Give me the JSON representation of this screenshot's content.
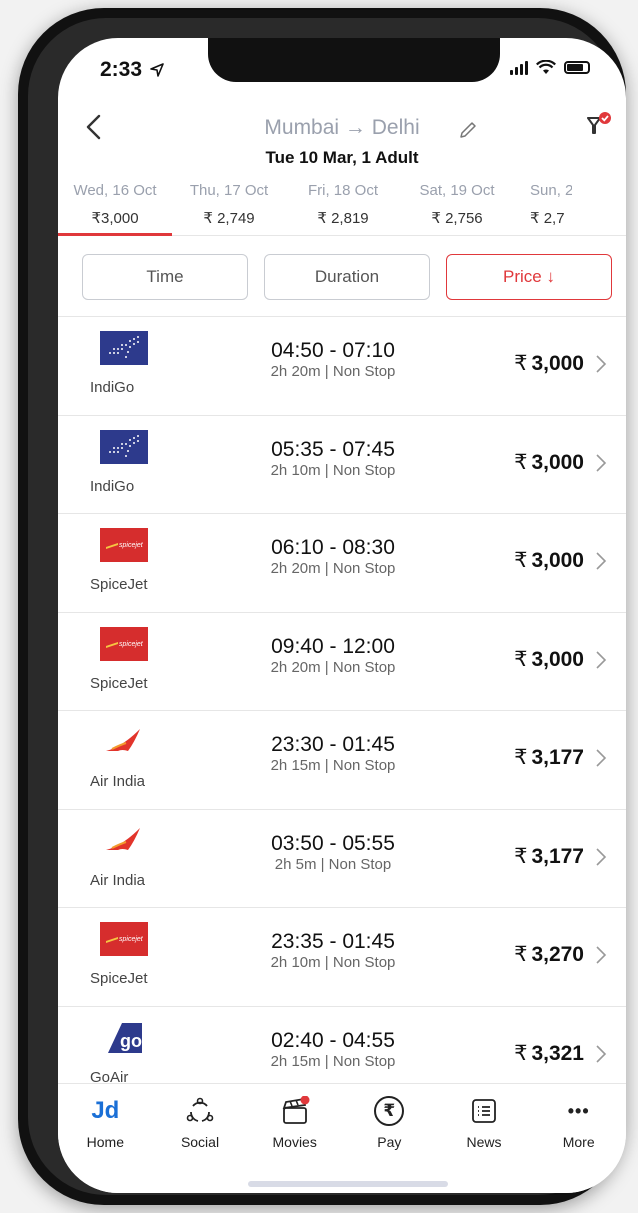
{
  "status": {
    "time": "2:33"
  },
  "header": {
    "route": "Mumbai → Delhi",
    "subtitle": "Tue 10 Mar, 1 Adult"
  },
  "dates": [
    {
      "date": "Wed, 16 Oct",
      "price": "₹3,000",
      "active": true
    },
    {
      "date": "Thu, 17 Oct",
      "price": "₹ 2,749"
    },
    {
      "date": "Fri, 18 Oct",
      "price": "₹ 2,819"
    },
    {
      "date": "Sat, 19 Oct",
      "price": "₹ 2,756"
    },
    {
      "date": "Sun, 2",
      "price": "₹ 2,7"
    }
  ],
  "sort": {
    "time": "Time",
    "duration": "Duration",
    "price": "Price ↓"
  },
  "flights": [
    {
      "airline": "IndiGo",
      "logo": "indigo",
      "times": "04:50 - 07:10",
      "meta": "2h 20m | Non Stop",
      "price": "3,000"
    },
    {
      "airline": "IndiGo",
      "logo": "indigo",
      "times": "05:35 - 07:45",
      "meta": "2h 10m | Non Stop",
      "price": "3,000"
    },
    {
      "airline": "SpiceJet",
      "logo": "spicejet",
      "times": "06:10 - 08:30",
      "meta": "2h 20m | Non Stop",
      "price": "3,000"
    },
    {
      "airline": "SpiceJet",
      "logo": "spicejet",
      "times": "09:40 - 12:00",
      "meta": "2h 20m | Non Stop",
      "price": "3,000"
    },
    {
      "airline": "Air India",
      "logo": "airindia",
      "times": "23:30 - 01:45",
      "meta": "2h 15m | Non Stop",
      "price": "3,177"
    },
    {
      "airline": "Air India",
      "logo": "airindia",
      "times": "03:50 - 05:55",
      "meta": "2h 5m | Non Stop",
      "price": "3,177"
    },
    {
      "airline": "SpiceJet",
      "logo": "spicejet",
      "times": "23:35 - 01:45",
      "meta": "2h 10m | Non Stop",
      "price": "3,270"
    },
    {
      "airline": "GoAir",
      "logo": "goair",
      "times": "02:40 - 04:55",
      "meta": "2h 15m | Non Stop",
      "price": "3,321"
    }
  ],
  "currency": "₹",
  "logo_text": {
    "spicejet": "spicejet",
    "goair": "go"
  },
  "nav": [
    {
      "label": "Home",
      "icon": "jd-logo-icon",
      "glyph": "Jd"
    },
    {
      "label": "Social",
      "icon": "social-icon"
    },
    {
      "label": "Movies",
      "icon": "clapperboard-icon"
    },
    {
      "label": "Pay",
      "icon": "rupee-icon",
      "glyph": "₹"
    },
    {
      "label": "News",
      "icon": "news-list-icon"
    },
    {
      "label": "More",
      "icon": "more-dots-icon",
      "glyph": "•••"
    }
  ],
  "colors": {
    "accent": "#e0383b",
    "indigo_blue": "#2d3a8c",
    "spicejet_red": "#d62d2d",
    "jd_blue": "#1a6fd6",
    "jd_orange": "#f5821f"
  }
}
